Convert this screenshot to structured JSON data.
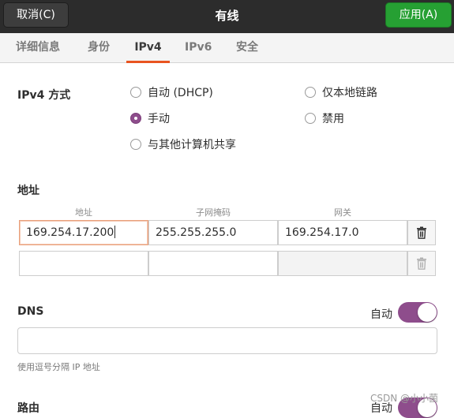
{
  "header": {
    "cancel_label": "取消(C)",
    "title": "有线",
    "apply_label": "应用(A)"
  },
  "tabs": [
    {
      "label": "详细信息"
    },
    {
      "label": "身份"
    },
    {
      "label": "IPv4",
      "active": true
    },
    {
      "label": "IPv6"
    },
    {
      "label": "安全"
    }
  ],
  "ipv4_method": {
    "label": "IPv4 方式",
    "options": [
      {
        "label": "自动 (DHCP)",
        "checked": false
      },
      {
        "label": "仅本地链路",
        "checked": false
      },
      {
        "label": "手动",
        "checked": true
      },
      {
        "label": "禁用",
        "checked": false
      },
      {
        "label": "与其他计算机共享",
        "checked": false
      }
    ]
  },
  "addresses": {
    "label": "地址",
    "columns": [
      "地址",
      "子网掩码",
      "网关"
    ],
    "rows": [
      {
        "address": "169.254.17.200",
        "netmask": "255.255.255.0",
        "gateway": "169.254.17.0"
      },
      {
        "address": "",
        "netmask": "",
        "gateway": ""
      }
    ]
  },
  "dns": {
    "label": "DNS",
    "auto_label": "自动",
    "auto_enabled": true,
    "value": "",
    "hint": "使用逗号分隔 IP 地址"
  },
  "routes": {
    "label": "路由",
    "auto_label": "自动",
    "auto_enabled": true
  },
  "watermark": "CSDN @小小菌",
  "colors": {
    "header_bg": "#2c2c2c",
    "apply_green": "#26a033",
    "tab_accent": "#e95420",
    "toggle_purple": "#8e4d8c"
  }
}
